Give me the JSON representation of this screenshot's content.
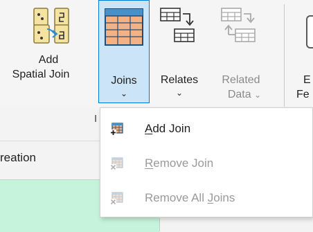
{
  "ribbon": {
    "add_spatial_join": {
      "line1": "Add",
      "line2": "Spatial Join"
    },
    "joins": {
      "label": "Joins",
      "chevron": "⌄"
    },
    "relates": {
      "label": "Relates",
      "chevron": "⌄"
    },
    "related_data": {
      "line1": "Related",
      "line2": "Data",
      "chevron": "⌄"
    },
    "cut_button": {
      "line1": "E",
      "line2": "Fe"
    },
    "group_label_fragment": "I"
  },
  "tab": {
    "label_fragment": "reation"
  },
  "menu": {
    "items": [
      {
        "pre": "",
        "u": "A",
        "post": "dd Join",
        "enabled": true,
        "icon": "add-join-icon"
      },
      {
        "pre": "",
        "u": "R",
        "post": "emove Join",
        "enabled": false,
        "icon": "remove-join-icon"
      },
      {
        "pre": "Remove All ",
        "u": "J",
        "post": "oins",
        "enabled": false,
        "icon": "remove-all-joins-icon"
      }
    ]
  },
  "colors": {
    "selected_bg": "#cce4f7",
    "selected_border": "#0078d4",
    "table_fill": "#f4b183",
    "table_line": "#1f4e79",
    "green_area": "#c6f3dc",
    "disabled_text": "#9a9a9a"
  }
}
